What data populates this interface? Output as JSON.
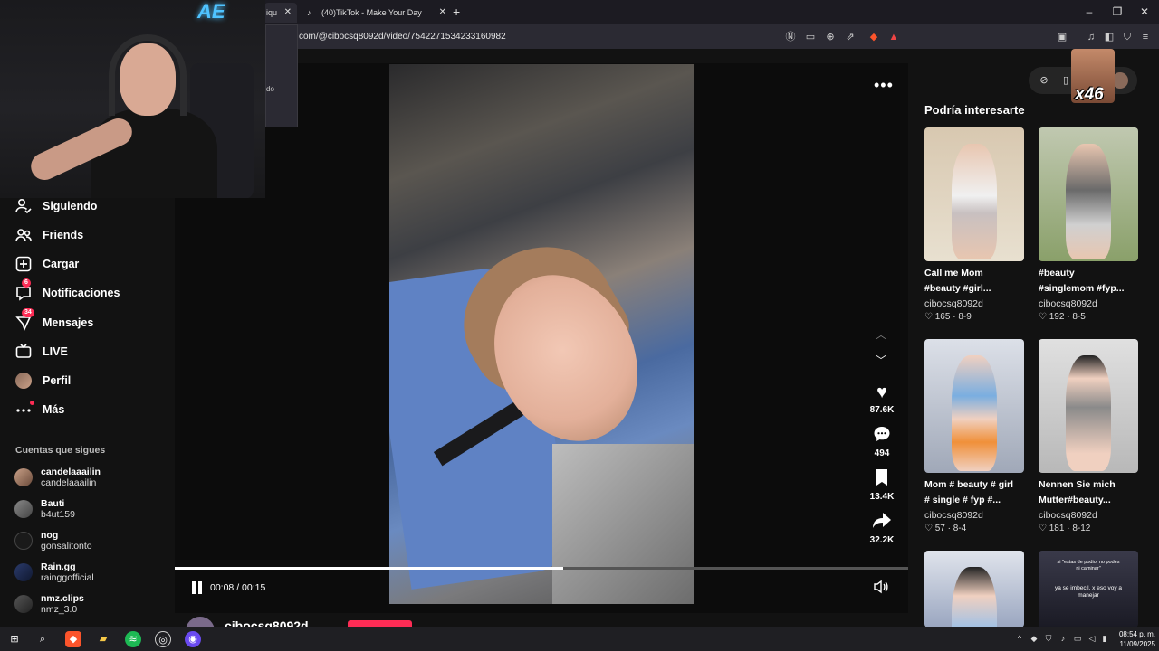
{
  "browser": {
    "active_tab_label": "iqu",
    "tiktok_tab_label": "(40)TikTok - Make Your Day",
    "url": "com/@cibocsq8092d/video/7542271534233160982",
    "popup_text": "do"
  },
  "webcam": {
    "neon_text": "AE"
  },
  "sidebar": {
    "nav": [
      {
        "label": "Siguiendo"
      },
      {
        "label": "Friends"
      },
      {
        "label": "Cargar"
      },
      {
        "label": "Notificaciones",
        "badge": "6"
      },
      {
        "label": "Mensajes",
        "badge": "34"
      },
      {
        "label": "LIVE"
      },
      {
        "label": "Perfil"
      },
      {
        "label": "Más"
      }
    ],
    "following_title": "Cuentas que sigues",
    "accounts": [
      {
        "name": "candelaaailin",
        "handle": "candelaaailin"
      },
      {
        "name": "Bauti",
        "handle": "b4ut159"
      },
      {
        "name": "nog",
        "handle": "gonsalitonto"
      },
      {
        "name": "Rain.gg",
        "handle": "rainggofficial"
      },
      {
        "name": "nmz.clips",
        "handle": "nmz_3.0"
      }
    ]
  },
  "video": {
    "time": "00:08 / 00:15",
    "progress": 0.53,
    "likes": "87.6K",
    "comments": "494",
    "saves": "13.4K",
    "shares": "32.2K",
    "author": "cibocsq8092d"
  },
  "rail": {
    "meme_text": "x46",
    "title": "Podría interesarte",
    "cards": [
      {
        "desc1": "Call me Mom",
        "desc2": "#beauty #girl...",
        "author": "cibocsq8092d",
        "likes": "165",
        "date": "8-9",
        "color1": "#d8c8b0",
        "color2": "#e8e0d0"
      },
      {
        "desc1": "#beauty",
        "desc2": "#singlemom #fyp...",
        "author": "cibocsq8092d",
        "likes": "192",
        "date": "8-5",
        "color1": "#8aa06a",
        "color2": "#c0c8b0"
      },
      {
        "desc1": "Mom # beauty # girl",
        "desc2": "# single # fyp #...",
        "author": "cibocsq8092d",
        "likes": "57",
        "date": "8-4",
        "color1": "#a0a8b8",
        "color2": "#dce0e8"
      },
      {
        "desc1": "Nennen Sie mich",
        "desc2": "Mutter#beauty...",
        "author": "cibocsq8092d",
        "likes": "181",
        "date": "8-12",
        "color1": "#b8b8b8",
        "color2": "#e0e0e0"
      },
      {
        "caption1": "si \"estas de podio, no podes",
        "caption2": "ni caminar\"",
        "caption3": "ya se imbecil, x eso voy a",
        "caption4": "manejar",
        "color1": "#9aa6c0",
        "color2": "#e0e4ec"
      },
      {
        "color1": "#1a1a24",
        "color2": "#3a3a4a"
      }
    ]
  },
  "taskbar": {
    "time": "08:54 p. m.",
    "date": "11/09/2025"
  }
}
